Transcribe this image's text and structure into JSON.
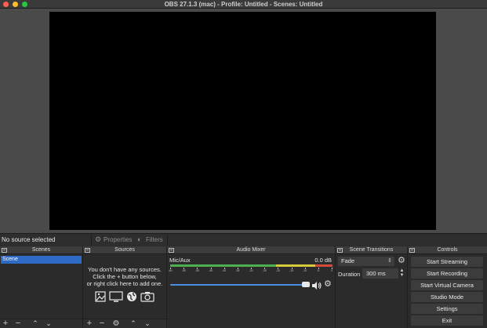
{
  "window": {
    "title": "OBS 27.1.3 (mac) - Profile: Untitled - Scenes: Untitled"
  },
  "context_bar": {
    "status": "No source selected",
    "properties_label": "Properties",
    "filters_label": "Filters"
  },
  "docks": {
    "scenes": {
      "title": "Scenes",
      "items": [
        "Scene"
      ],
      "selected_index": 0
    },
    "sources": {
      "title": "Sources",
      "hint_line1": "You don't have any sources.",
      "hint_line2": "Click the + button below,",
      "hint_line3": "or right click here to add one."
    },
    "audio_mixer": {
      "title": "Audio Mixer",
      "channel_name": "Mic/Aux",
      "level": "0.0 dB",
      "ticks": [
        "-60",
        "-55",
        "-50",
        "-45",
        "-40",
        "-35",
        "-30",
        "-25",
        "-20",
        "-15",
        "-10",
        "-5",
        "0"
      ],
      "volume_fraction": 1.0
    },
    "scene_transitions": {
      "title": "Scene Transitions",
      "transition": "Fade",
      "duration_label": "Duration",
      "duration_value": "300 ms"
    },
    "controls": {
      "title": "Controls",
      "buttons": [
        "Start Streaming",
        "Start Recording",
        "Start Virtual Camera",
        "Studio Mode",
        "Settings",
        "Exit"
      ]
    }
  },
  "colors": {
    "selection": "#2d6bc4",
    "meter_green": "#4caf50",
    "meter_yellow": "#d6c93b",
    "meter_red": "#d64a3b",
    "slider": "#4d8ee0"
  }
}
